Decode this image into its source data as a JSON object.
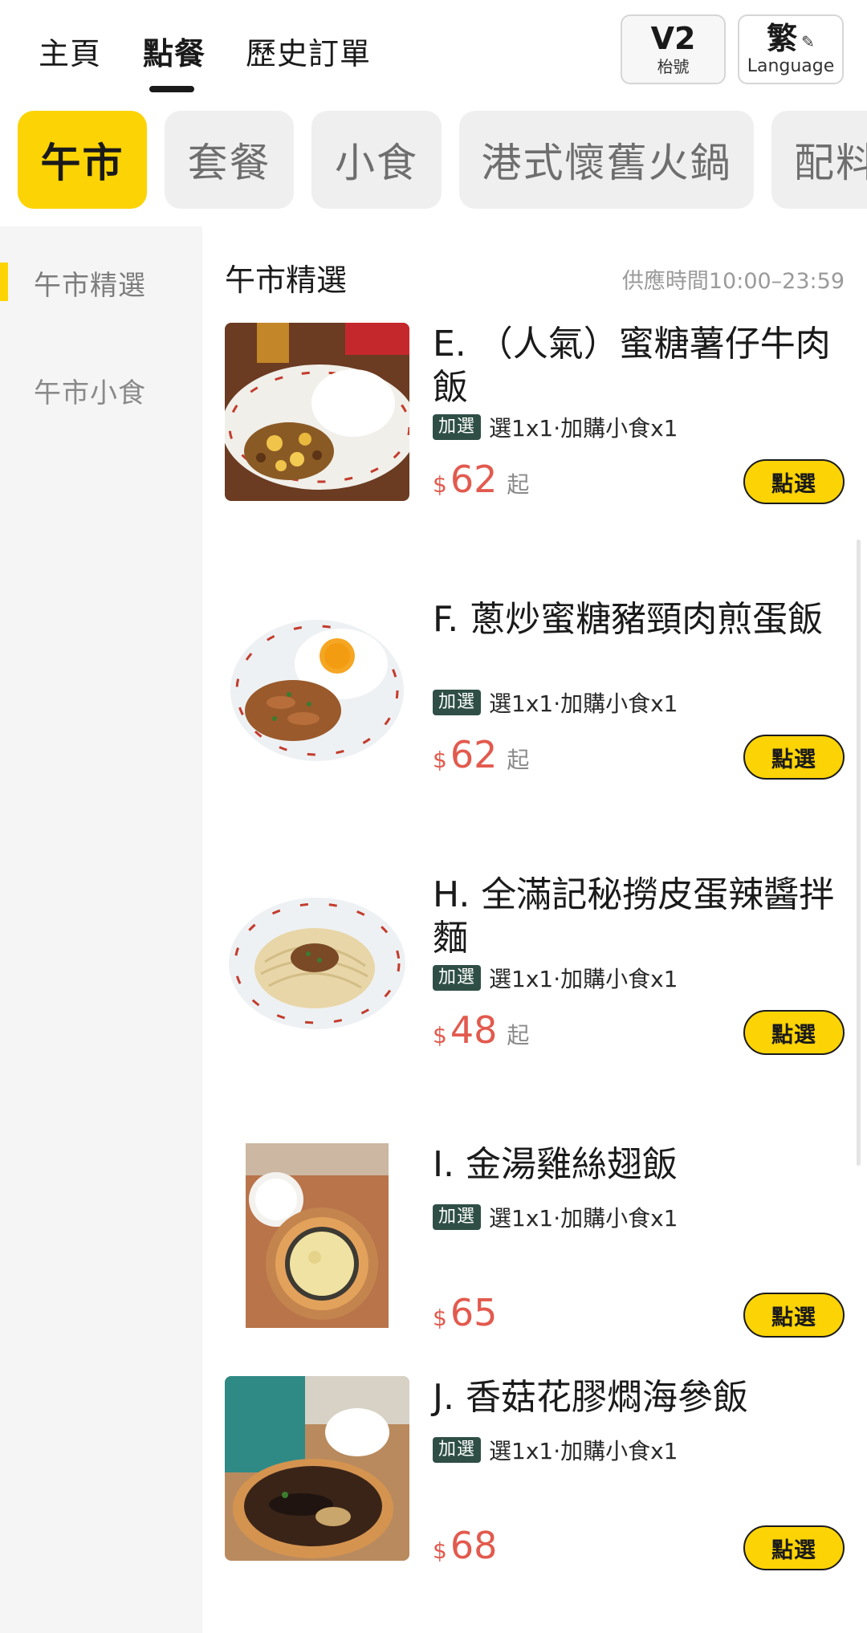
{
  "nav": {
    "tabs": [
      "主頁",
      "點餐",
      "歷史訂單"
    ],
    "active_tab": "點餐",
    "table": {
      "label": "V2",
      "sub": "枱號"
    },
    "language": {
      "label": "繁",
      "sub": "Language",
      "icon": "pencil-icon"
    }
  },
  "categories": [
    "午市",
    "套餐",
    "小食",
    "港式懷舊火鍋",
    "配料"
  ],
  "active_category": "午市",
  "sidebar": {
    "items": [
      "午市精選",
      "午市小食"
    ],
    "active": "午市精選"
  },
  "section": {
    "title": "午市精選",
    "hours": "供應時間10:00–23:59"
  },
  "colors": {
    "accent": "#fcd305",
    "price": "#e25a4e",
    "badge": "#2f4f46"
  },
  "items": [
    {
      "name": "E. （人氣）蜜糖薯仔牛肉飯",
      "badge": "加選",
      "options": "選1x1·加購小食x1",
      "currency": "$",
      "price": "62",
      "suffix": "起",
      "button": "點選"
    },
    {
      "name": "F. 蔥炒蜜糖豬頸肉煎蛋飯",
      "badge": "加選",
      "options": "選1x1·加購小食x1",
      "currency": "$",
      "price": "62",
      "suffix": "起",
      "button": "點選"
    },
    {
      "name": "H. 全滿記秘撈皮蛋辣醬拌麵",
      "badge": "加選",
      "options": "選1x1·加購小食x1",
      "currency": "$",
      "price": "48",
      "suffix": "起",
      "button": "點選"
    },
    {
      "name": "I. 金湯雞絲翅飯",
      "badge": "加選",
      "options": "選1x1·加購小食x1",
      "currency": "$",
      "price": "65",
      "suffix": "",
      "button": "點選"
    },
    {
      "name": "J. 香菇花膠燜海參飯",
      "badge": "加選",
      "options": "選1x1·加購小食x1",
      "currency": "$",
      "price": "68",
      "suffix": "",
      "button": "點選"
    }
  ]
}
